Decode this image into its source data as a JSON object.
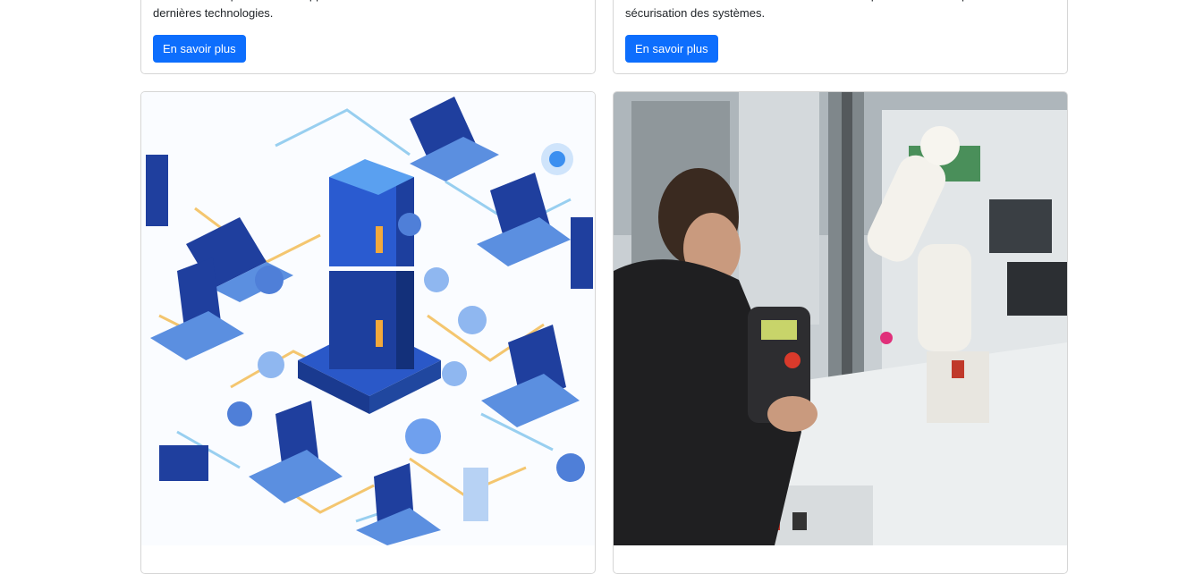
{
  "cards_top": [
    {
      "text": "Formation complète en développement web front-end et back-end avec les dernières technologies.",
      "button_label": "En savoir plus"
    },
    {
      "text": "Maîtrisez l'administration des réseaux informatiques et les techniques de sécurisation des systèmes.",
      "button_label": "En savoir plus"
    }
  ],
  "cards_bottom": [
    {
      "image": "network-server-illustration"
    },
    {
      "image": "industrial-robotics-photo"
    }
  ],
  "colors": {
    "primary_button": "#0d6efd",
    "card_border": "#d6d6d6"
  }
}
